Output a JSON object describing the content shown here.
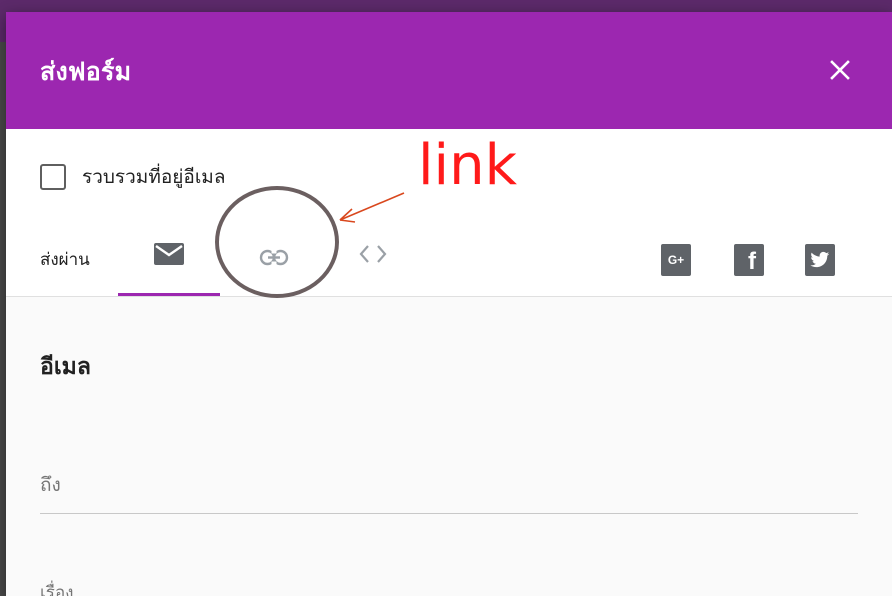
{
  "dialog": {
    "title": "ส่งฟอร์ม",
    "close_icon": "close-icon",
    "header_color": "#9c27b0"
  },
  "collect": {
    "label": "รวบรวมที่อยู่อีเมล",
    "checked": false
  },
  "send_via": {
    "label": "ส่งผ่าน",
    "tabs": [
      {
        "icon": "email-icon",
        "selected": true
      },
      {
        "icon": "link-icon",
        "selected": false
      },
      {
        "icon": "embed-code-icon",
        "selected": false
      }
    ],
    "accent_color": "#9c27b0"
  },
  "social": [
    {
      "icon": "google-plus-icon",
      "text": "G+"
    },
    {
      "icon": "facebook-icon",
      "text": "f"
    },
    {
      "icon": "twitter-icon",
      "text": ""
    }
  ],
  "email_section": {
    "title": "อีเมล",
    "to_placeholder": "ถึง",
    "subject_label": "เรื่อง"
  },
  "annotation": {
    "text": "link",
    "color": "#ff1a1a",
    "circle_color": "#6b5f60"
  }
}
